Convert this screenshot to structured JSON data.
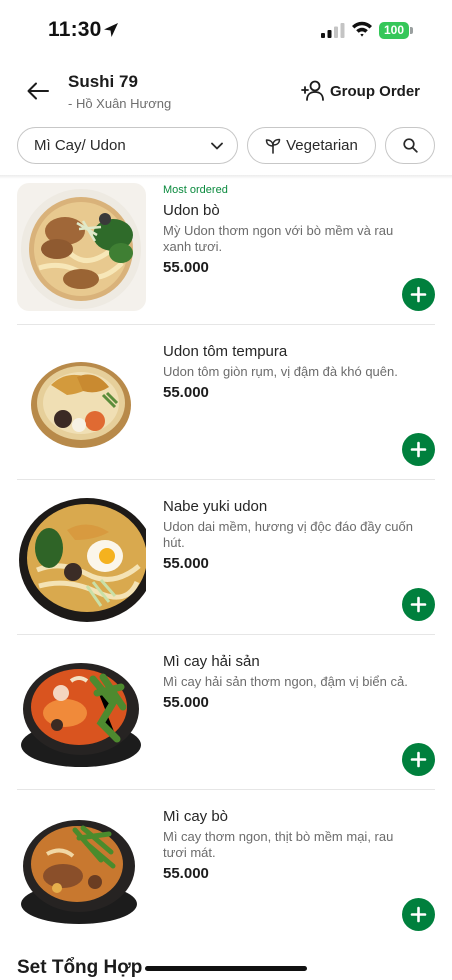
{
  "status_bar": {
    "time": "11:30",
    "battery": "100"
  },
  "header": {
    "store_name": "Sushi 79",
    "store_address": "- Hồ Xuân Hương",
    "group_order_label": "Group Order"
  },
  "filters": {
    "category_label": "Mì Cay/ Udon",
    "vegetarian_label": "Vegetarian"
  },
  "items": [
    {
      "badge": "Most ordered",
      "name": "Udon bò",
      "desc": "Mỳ Udon thơm ngon với bò mềm và rau xanh tươi.",
      "price": "55.000"
    },
    {
      "badge": "",
      "name": "Udon tôm tempura",
      "desc": "Udon tôm giòn rụm, vị đậm đà khó quên.",
      "price": "55.000"
    },
    {
      "badge": "",
      "name": "Nabe yuki udon",
      "desc": "Udon dai mềm, hương vị độc đáo đầy cuốn hút.",
      "price": "55.000"
    },
    {
      "badge": "",
      "name": "Mì cay hải sản",
      "desc": "Mì cay hải sản thơm ngon, đậm vị biển cả.",
      "price": "55.000"
    },
    {
      "badge": "",
      "name": "Mì cay bò",
      "desc": "Mì cay thơm ngon, thịt bò mềm mại, rau tươi mát.",
      "price": "55.000"
    }
  ],
  "next_section_title": "Set Tổng Hợp",
  "colors": {
    "accent_green": "#00803d",
    "badge_green": "#0b8a3e",
    "battery_green": "#35c759"
  },
  "icons": [
    "location-arrow-icon",
    "signal-icon",
    "wifi-icon",
    "battery-icon",
    "back-arrow-icon",
    "group-add-icon",
    "chevron-down-icon",
    "sprout-icon",
    "search-icon",
    "plus-icon"
  ]
}
